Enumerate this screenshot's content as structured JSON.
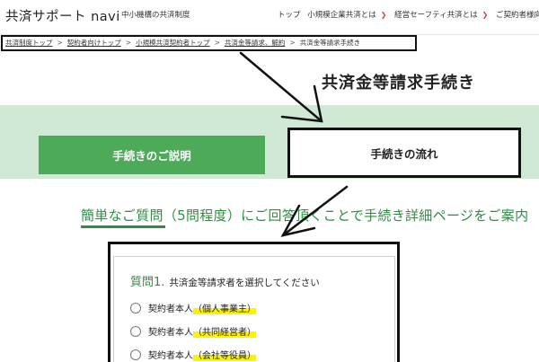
{
  "header": {
    "logo": "共済サポート navi",
    "logo_sub": "中小機構の共済制度",
    "nav": {
      "item1": "トップ",
      "item2": "小規模企業共済とは",
      "item3": "経営セーフティ共済とは",
      "item4": "ご契約者様向"
    }
  },
  "breadcrumb": {
    "c1": "共済制度トップ",
    "c2": "契約者向けトップ",
    "c3": "小規模共済契約者トップ",
    "c4": "共済金等請求、解約",
    "c5": "共済金等請求手続き"
  },
  "page_title": "共済金等請求手続き",
  "tabs": {
    "explain": "手続きのご説明",
    "flow": "手続きの流れ"
  },
  "intro": "簡単なご質問（5問程度）にご回答頂くことで手続き詳細ページをご案内",
  "question": {
    "number": "質問1.",
    "text": "共済金等請求者を選択してください",
    "options": {
      "o1_prefix": "契約者本人",
      "o1_hl": "（個人事業主）",
      "o2_prefix": "契約者本人",
      "o2_hl": "（共同経営者）",
      "o3_prefix": "契約者本人",
      "o3_hl": "（会社等役員）"
    }
  },
  "colors": {
    "green": "#4caa59",
    "light_green": "#cfe9d4",
    "chevron_red": "#e0403a",
    "highlight": "#fff200"
  },
  "icons": {
    "nav_chevron": "chevron-down-icon",
    "radio": "radio-icon"
  }
}
